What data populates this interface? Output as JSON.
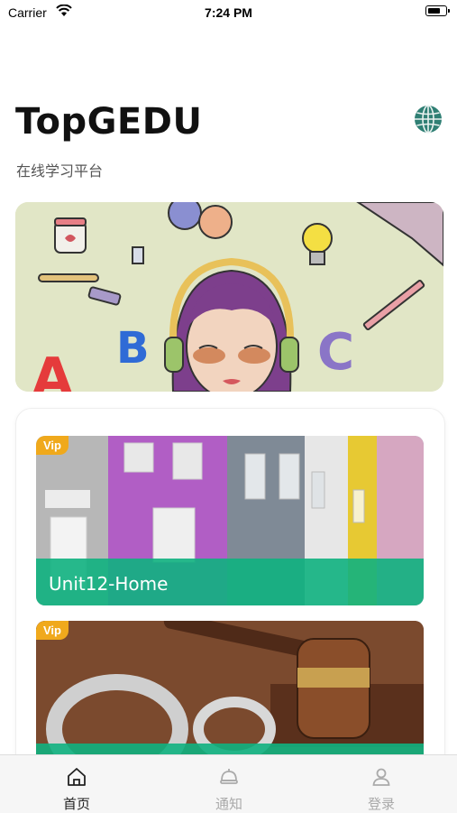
{
  "status_bar": {
    "carrier": "Carrier",
    "time": "7:24 PM"
  },
  "header": {
    "title": "TopGEDU",
    "subtitle": "在线学习平台",
    "language_icon": "globe-icon"
  },
  "courses": [
    {
      "badge": "Vip",
      "title": "Unit12-Home"
    },
    {
      "badge": "Vip",
      "title": ""
    }
  ],
  "tabbar": {
    "items": [
      {
        "label": "首页",
        "icon": "home-icon",
        "active": true
      },
      {
        "label": "通知",
        "icon": "notification-icon",
        "active": false
      },
      {
        "label": "登录",
        "icon": "user-icon",
        "active": false
      }
    ],
    "active_color": "#222222",
    "inactive_color": "#aaaaaa"
  },
  "colors": {
    "accent": "#10b180",
    "vip": "#f0a91c"
  }
}
